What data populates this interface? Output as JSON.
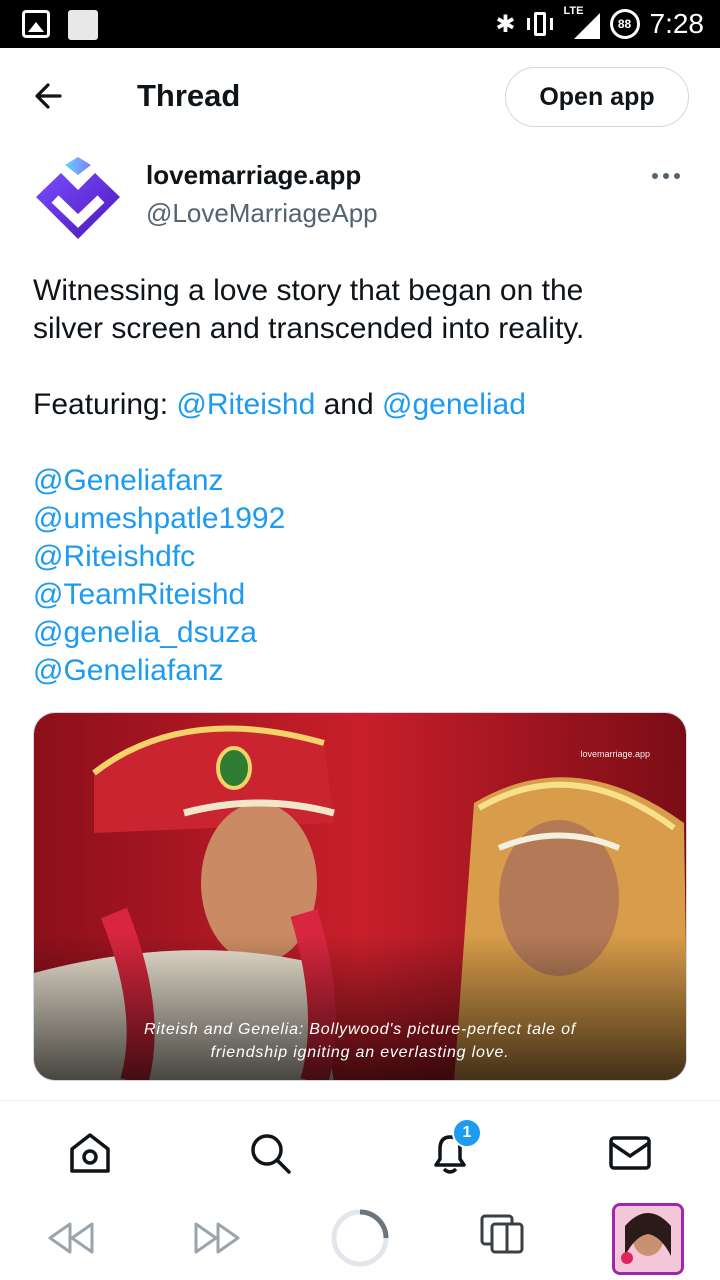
{
  "status_bar": {
    "time": "7:28",
    "battery": "88",
    "network": "LTE"
  },
  "header": {
    "title": "Thread",
    "open_app_label": "Open app"
  },
  "author": {
    "display_name": "lovemarriage.app",
    "handle": "@LoveMarriageApp"
  },
  "tweet": {
    "line1": "Witnessing a love story that began on the",
    "line2": "silver screen and transcended into reality.",
    "featuring_prefix": "Featuring: ",
    "featuring_mention1": "@Riteishd",
    "featuring_and": " and ",
    "featuring_mention2": "@geneliad",
    "mentions": [
      "@Geneliafanz",
      "@umeshpatle1992",
      "@Riteishdfc",
      "@TeamRiteishd",
      "@genelia_dsuza",
      "@Geneliafanz"
    ]
  },
  "media": {
    "watermark": "lovemarriage.app",
    "caption_line1": "Riteish and Genelia: Bollywood's picture-perfect tale of",
    "caption_line2": "friendship igniting an everlasting love."
  },
  "nav": {
    "notification_count": "1",
    "items": [
      "home-icon",
      "search-icon",
      "bell-icon",
      "mail-icon"
    ]
  },
  "browser_bar": {
    "items": [
      "rewind-icon",
      "fast-forward-icon",
      "loading-spinner",
      "tabs-icon",
      "profile-thumbnail"
    ]
  },
  "colors": {
    "accent": "#1d9bf0",
    "text": "#0f1419",
    "secondary": "#536471",
    "brand_purple": "#6a2fd8"
  }
}
